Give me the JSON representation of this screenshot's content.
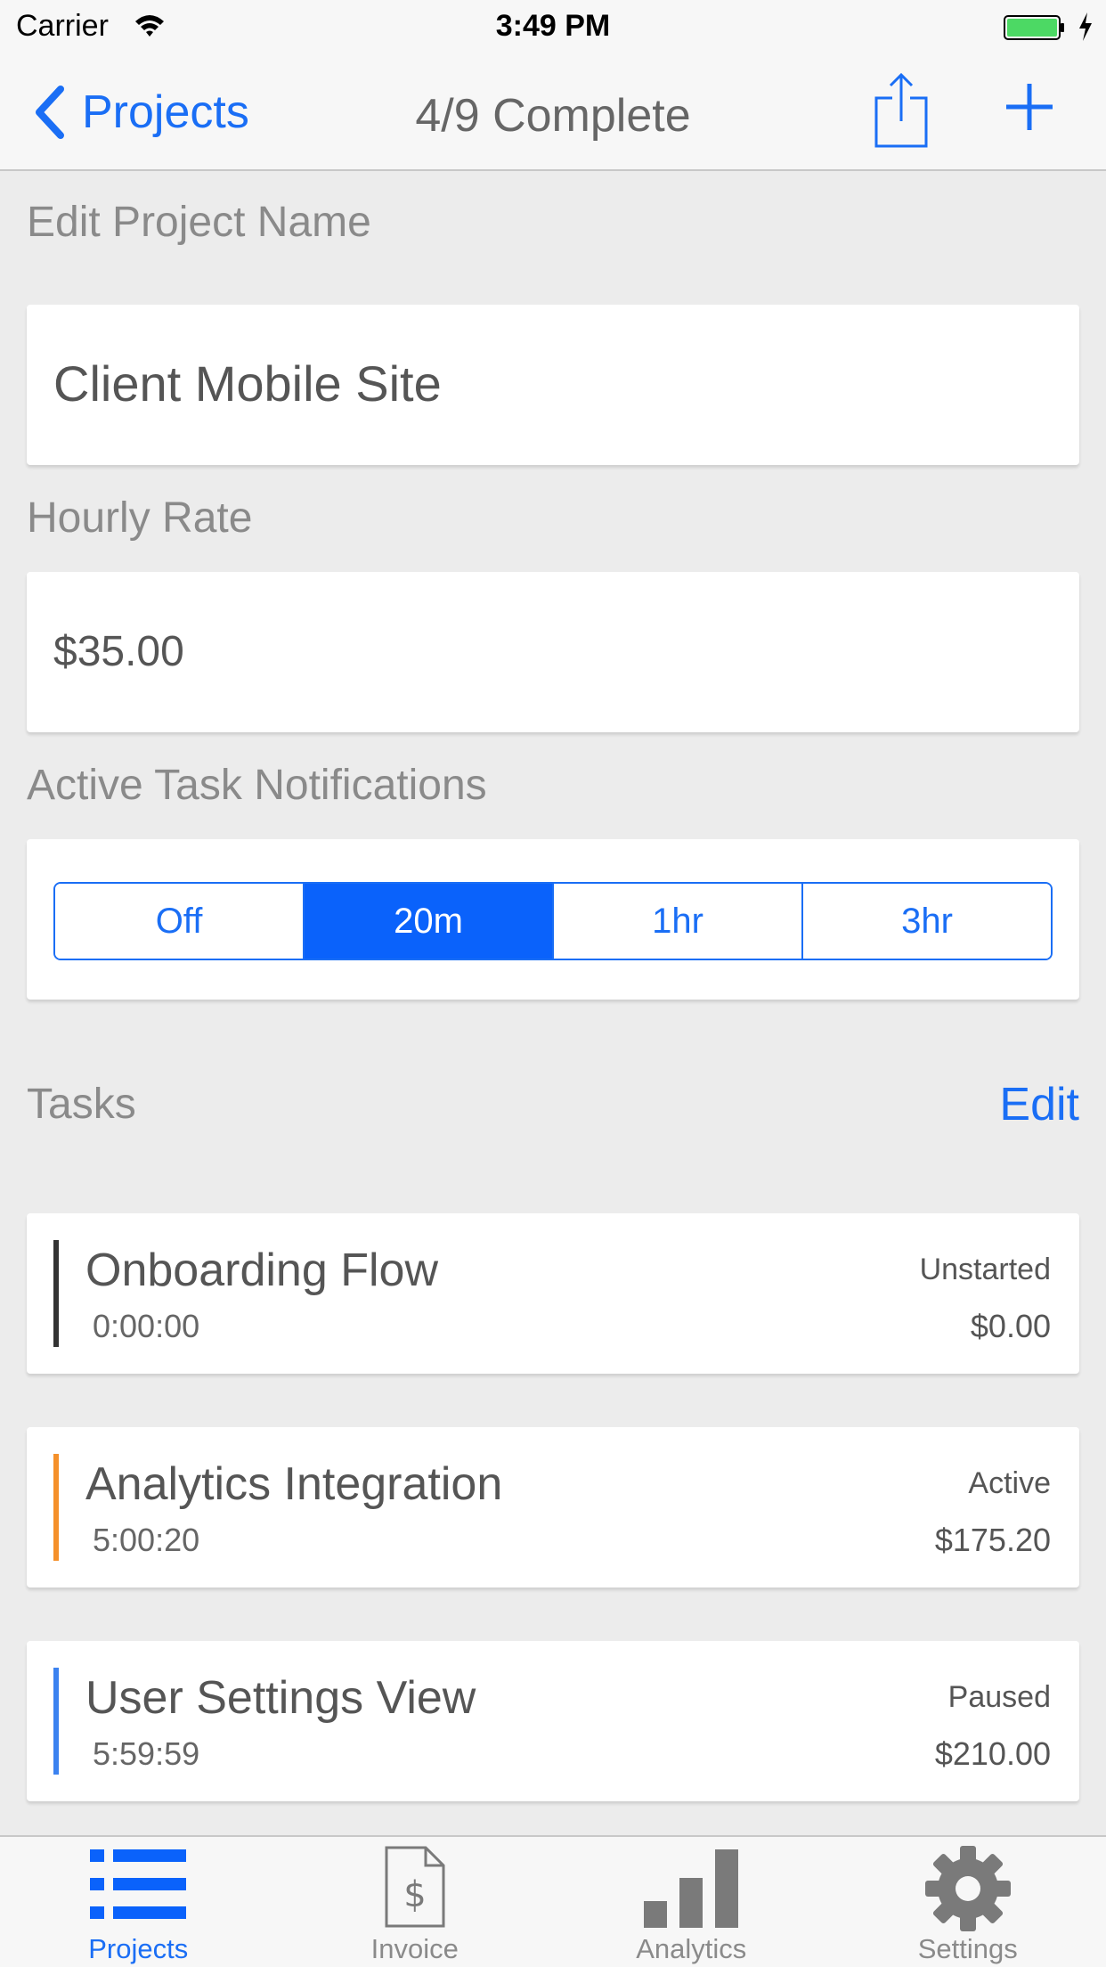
{
  "status_bar": {
    "carrier": "Carrier",
    "time": "3:49 PM"
  },
  "nav": {
    "back_label": "Projects",
    "title": "4/9 Complete"
  },
  "project_name": {
    "label": "Edit Project Name",
    "value": "Client Mobile Site"
  },
  "hourly_rate": {
    "label": "Hourly Rate",
    "value": "$35.00"
  },
  "notifications": {
    "label": "Active Task Notifications",
    "options": [
      "Off",
      "20m",
      "1hr",
      "3hr"
    ],
    "selected": "20m"
  },
  "tasks": {
    "label": "Tasks",
    "edit_label": "Edit",
    "items": [
      {
        "name": "Onboarding Flow",
        "time": "0:00:00",
        "status": "Unstarted",
        "amount": "$0.00",
        "color": "#333333"
      },
      {
        "name": "Analytics Integration",
        "time": "5:00:20",
        "status": "Active",
        "amount": "$175.20",
        "color": "#f5902a"
      },
      {
        "name": "User Settings View",
        "time": "5:59:59",
        "status": "Paused",
        "amount": "$210.00",
        "color": "#3b82f0"
      }
    ]
  },
  "tab_bar": {
    "items": [
      {
        "label": "Projects",
        "icon": "list-icon",
        "active": true
      },
      {
        "label": "Invoice",
        "icon": "invoice-icon",
        "active": false
      },
      {
        "label": "Analytics",
        "icon": "bar-chart-icon",
        "active": false
      },
      {
        "label": "Settings",
        "icon": "gear-icon",
        "active": false
      }
    ]
  },
  "colors": {
    "accent": "#1a6ef5",
    "selected_segment": "#0a62fb",
    "background": "#ececec"
  }
}
